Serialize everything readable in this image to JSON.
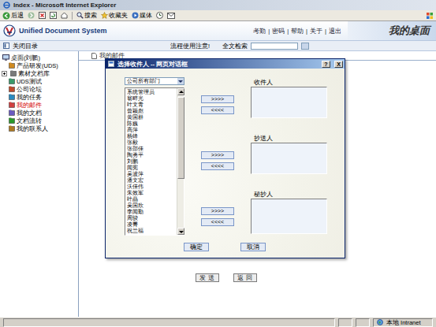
{
  "window": {
    "title": "Index - Microsoft Internet Explorer"
  },
  "toolbar": {
    "back": "后退",
    "buttons": [
      "搜索",
      "收藏夹",
      "媒体"
    ]
  },
  "header": {
    "app_name": "Unified Document System",
    "links": [
      "考勤",
      "密码",
      "帮助",
      "关于",
      "退出"
    ],
    "separator": "|",
    "desk_title": "我的桌面",
    "notice": "流程使用注意!",
    "search": {
      "label": "全文检索",
      "value": ""
    }
  },
  "sidebar": {
    "toggle": "关闭目录",
    "items": [
      {
        "label": "桌面(刘鹏)",
        "kind": "root",
        "collapsed": false,
        "selected": false
      },
      {
        "label": "产品研发(UDS)",
        "kind": "node",
        "collapsed": false,
        "selected": false
      },
      {
        "label": "素材文档库",
        "kind": "node",
        "collapsed": true,
        "selected": false
      },
      {
        "label": "UDS测试",
        "kind": "node",
        "collapsed": false,
        "selected": false
      },
      {
        "label": "公司论坛",
        "kind": "node",
        "collapsed": false,
        "selected": false
      },
      {
        "label": "我的任务",
        "kind": "node",
        "collapsed": false,
        "selected": false
      },
      {
        "label": "我的邮件",
        "kind": "node",
        "collapsed": false,
        "selected": true
      },
      {
        "label": "我的文档",
        "kind": "node",
        "collapsed": false,
        "selected": false
      },
      {
        "label": "文档流转",
        "kind": "node",
        "collapsed": false,
        "selected": false
      },
      {
        "label": "我的联系人",
        "kind": "node",
        "collapsed": false,
        "selected": false
      }
    ]
  },
  "main": {
    "tab": "我的邮件",
    "buttons": [
      "发 送",
      "返 回"
    ]
  },
  "dialog": {
    "title": "选择收件人 -- 网页对话框",
    "help": "?",
    "close": "X",
    "department": "公司所有部门",
    "people": [
      "系统管理员",
      "翁畔光",
      "叶文青",
      "曾颖彪",
      "黄国群",
      "陈巍",
      "高萍",
      "杨锋",
      "张毅",
      "张邵佳",
      "陶勇平",
      "刘鹏",
      "闻宪",
      "吴波萍",
      "潘文宏",
      "沃佳伟",
      "朱效军",
      "叶晶",
      "吴国欣",
      "李闻勤",
      "周骏",
      "凌菁",
      "祝兰福"
    ],
    "people_scroll": {
      "level": 0.62
    },
    "targets": [
      {
        "label": "收件人",
        "add": ">>>>",
        "remove": "<<<<",
        "recipients": []
      },
      {
        "label": "抄送人",
        "add": ">>>>",
        "remove": "<<<<",
        "recipients": []
      },
      {
        "label": "秘抄人",
        "add": ">>>>",
        "remove": "<<<<",
        "recipients": []
      }
    ],
    "buttons": [
      "确定",
      "取消"
    ]
  },
  "status_bar": {
    "zone": "本地 Intranet"
  }
}
